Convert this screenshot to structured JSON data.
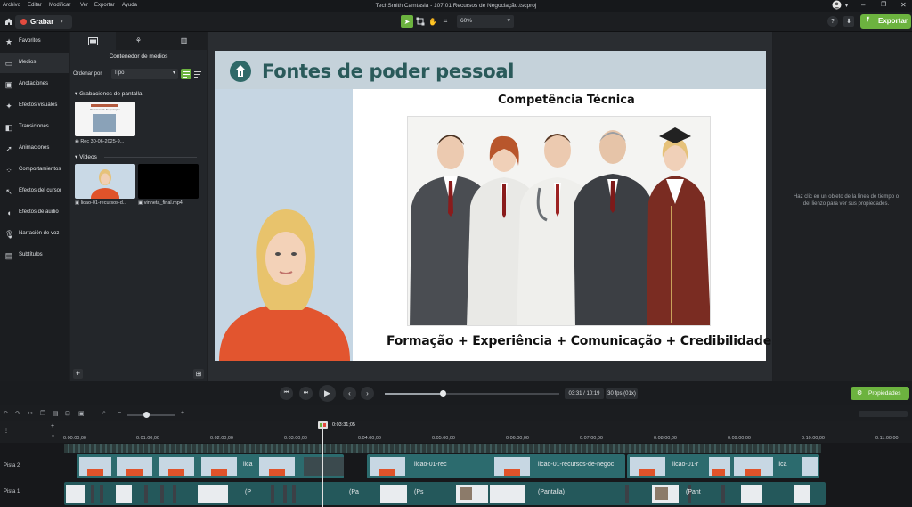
{
  "menubar": {
    "items": [
      "Archivo",
      "Editar",
      "Modificar",
      "Ver",
      "Exportar",
      "Ayuda"
    ],
    "title": "TechSmith Camtasia - 107.01 Recursos de Negociação.tscproj"
  },
  "toolbar": {
    "record_label": "Grabar",
    "zoom_value": "60%",
    "export_label": "Exportar",
    "help_label": "?"
  },
  "sidebar": {
    "items": [
      {
        "label": "Favoritos",
        "icon": "star-icon"
      },
      {
        "label": "Medios",
        "icon": "film-icon"
      },
      {
        "label": "Anotaciones",
        "icon": "annotation-icon"
      },
      {
        "label": "Efectos visuales",
        "icon": "wand-icon"
      },
      {
        "label": "Transiciones",
        "icon": "transition-icon"
      },
      {
        "label": "Animaciones",
        "icon": "animation-icon"
      },
      {
        "label": "Comportamientos",
        "icon": "behavior-icon"
      },
      {
        "label": "Efectos del cursor",
        "icon": "cursor-icon"
      },
      {
        "label": "Efectos de audio",
        "icon": "audio-icon"
      },
      {
        "label": "Narración de voz",
        "icon": "microphone-icon"
      },
      {
        "label": "Subtítulos",
        "icon": "captions-icon"
      }
    ]
  },
  "media_bin": {
    "title": "Contenedor de medios",
    "sort_label": "Ordenar por",
    "sort_value": "Tipo",
    "sections": {
      "screen_recordings": "Grabaciones de pantalla",
      "videos": "Videos"
    },
    "recordings": [
      {
        "label": "Rec 30-06-2025-9..."
      }
    ],
    "videos": [
      {
        "label": "licao-01-recursos-d..."
      },
      {
        "label": "vinheta_final.mp4"
      }
    ],
    "thumb_recording_title": "Recursos de Negociação"
  },
  "slide": {
    "title": "Fontes de poder pessoal",
    "subtitle": "Competência Técnica",
    "formula": "Formação + Experiência + Comunicação + Credibilidade"
  },
  "properties": {
    "hint": "Haz clic en un objeto de la línea de tiempo o del lienzo para ver sus propiedades.",
    "button_label": "Propiedades"
  },
  "playback": {
    "position_fraction": 0.33,
    "time": "03:31 / 10:19",
    "fps": "30 fps (01x)"
  },
  "timeline": {
    "playhead_time": "0:03:31;05",
    "ruler": [
      "0:00:00;00",
      "0:01:00;00",
      "0:02:00;00",
      "0:03:00;00",
      "0:04:00;00",
      "0:05:00;00",
      "0:06:00;00",
      "0:07:00;00",
      "0:08:00;00",
      "0:09:00;00",
      "0:10:00;00",
      "0:11:00;00"
    ],
    "tracks": [
      {
        "label": "Pista 2",
        "clip_texts": [
          "lica",
          "licao-01-rec",
          "licao-01-recursos-de-negoc",
          "licao-01-r",
          "lica"
        ]
      },
      {
        "label": "Pista 1",
        "clip_texts": [
          "(P",
          "(Pa",
          "(Ps",
          "(Pantalla)",
          "(Pant"
        ]
      }
    ]
  },
  "colors": {
    "accent_green": "#6cb33f",
    "record_red": "#e34b3f",
    "slide_title": "#2a5a5a",
    "timeline_clip": "#2c6b6e"
  }
}
